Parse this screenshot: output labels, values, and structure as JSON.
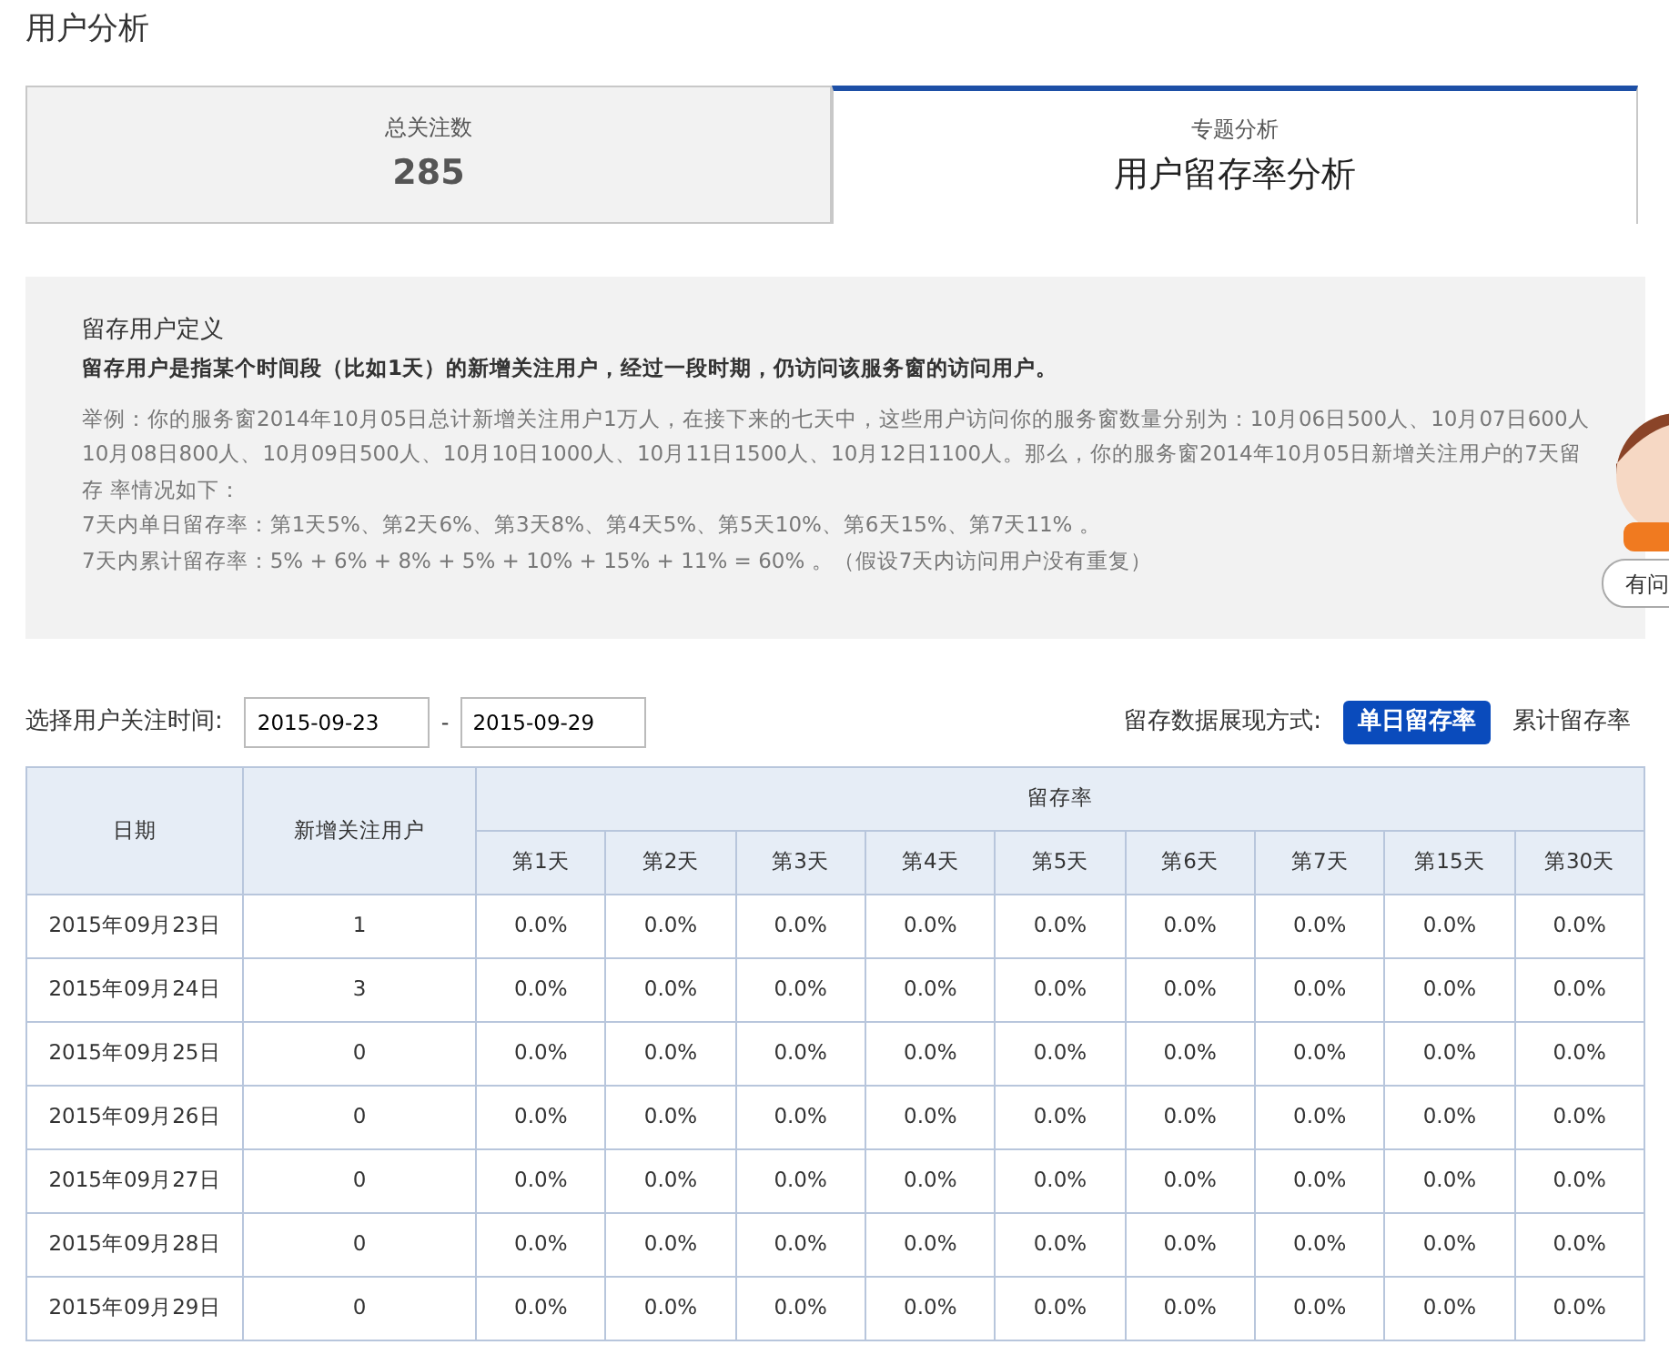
{
  "page_title": "用户分析",
  "tabs": [
    {
      "label": "总关注数",
      "value": "285",
      "selected": false
    },
    {
      "label": "专题分析",
      "value": "用户留存率分析",
      "selected": true
    }
  ],
  "definition": {
    "heading": "留存用户定义",
    "summary": "留存用户是指某个时间段（比如1天）的新增关注用户，经过一段时期，仍访问该服务窗的访问用户。",
    "example_lines": [
      "举例：你的服务窗2014年10月05日总计新增关注用户1万人，在接下来的七天中，这些用户访问你的服务窗数量分别为：10月06日500人、10月07日600人 10月08日800人、10月09日500人、10月10日1000人、10月11日1500人、10月12日1100人。那么，你的服务窗2014年10月05日新增关注用户的7天留存 率情况如下：",
      "7天内单日留存率：第1天5%、第2天6%、第3天8%、第4天5%、第5天10%、第6天15%、第7天11% 。",
      "7天内累计留存率：5% + 6% + 8% + 5% + 10% + 15% + 11% = 60% 。（假设7天内访问用户没有重复）"
    ]
  },
  "help_button": {
    "label": "有问"
  },
  "filter": {
    "label": "选择用户关注时间:",
    "start": "2015-09-23",
    "separator": "-",
    "end": "2015-09-29"
  },
  "display_mode": {
    "label": "留存数据展现方式:",
    "options": [
      {
        "label": "单日留存率",
        "selected": true
      },
      {
        "label": "累计留存率",
        "selected": false
      }
    ]
  },
  "table": {
    "columns": [
      "日期",
      "新增关注用户"
    ],
    "group_header": "留存率",
    "day_columns": [
      "第1天",
      "第2天",
      "第3天",
      "第4天",
      "第5天",
      "第6天",
      "第7天",
      "第15天",
      "第30天"
    ],
    "rows": [
      {
        "date": "2015年09月23日",
        "new_users": "1",
        "rates": [
          "0.0%",
          "0.0%",
          "0.0%",
          "0.0%",
          "0.0%",
          "0.0%",
          "0.0%",
          "0.0%",
          "0.0%"
        ]
      },
      {
        "date": "2015年09月24日",
        "new_users": "3",
        "rates": [
          "0.0%",
          "0.0%",
          "0.0%",
          "0.0%",
          "0.0%",
          "0.0%",
          "0.0%",
          "0.0%",
          "0.0%"
        ]
      },
      {
        "date": "2015年09月25日",
        "new_users": "0",
        "rates": [
          "0.0%",
          "0.0%",
          "0.0%",
          "0.0%",
          "0.0%",
          "0.0%",
          "0.0%",
          "0.0%",
          "0.0%"
        ]
      },
      {
        "date": "2015年09月26日",
        "new_users": "0",
        "rates": [
          "0.0%",
          "0.0%",
          "0.0%",
          "0.0%",
          "0.0%",
          "0.0%",
          "0.0%",
          "0.0%",
          "0.0%"
        ]
      },
      {
        "date": "2015年09月27日",
        "new_users": "0",
        "rates": [
          "0.0%",
          "0.0%",
          "0.0%",
          "0.0%",
          "0.0%",
          "0.0%",
          "0.0%",
          "0.0%",
          "0.0%"
        ]
      },
      {
        "date": "2015年09月28日",
        "new_users": "0",
        "rates": [
          "0.0%",
          "0.0%",
          "0.0%",
          "0.0%",
          "0.0%",
          "0.0%",
          "0.0%",
          "0.0%",
          "0.0%"
        ]
      },
      {
        "date": "2015年09月29日",
        "new_users": "0",
        "rates": [
          "0.0%",
          "0.0%",
          "0.0%",
          "0.0%",
          "0.0%",
          "0.0%",
          "0.0%",
          "0.0%",
          "0.0%"
        ]
      }
    ]
  }
}
